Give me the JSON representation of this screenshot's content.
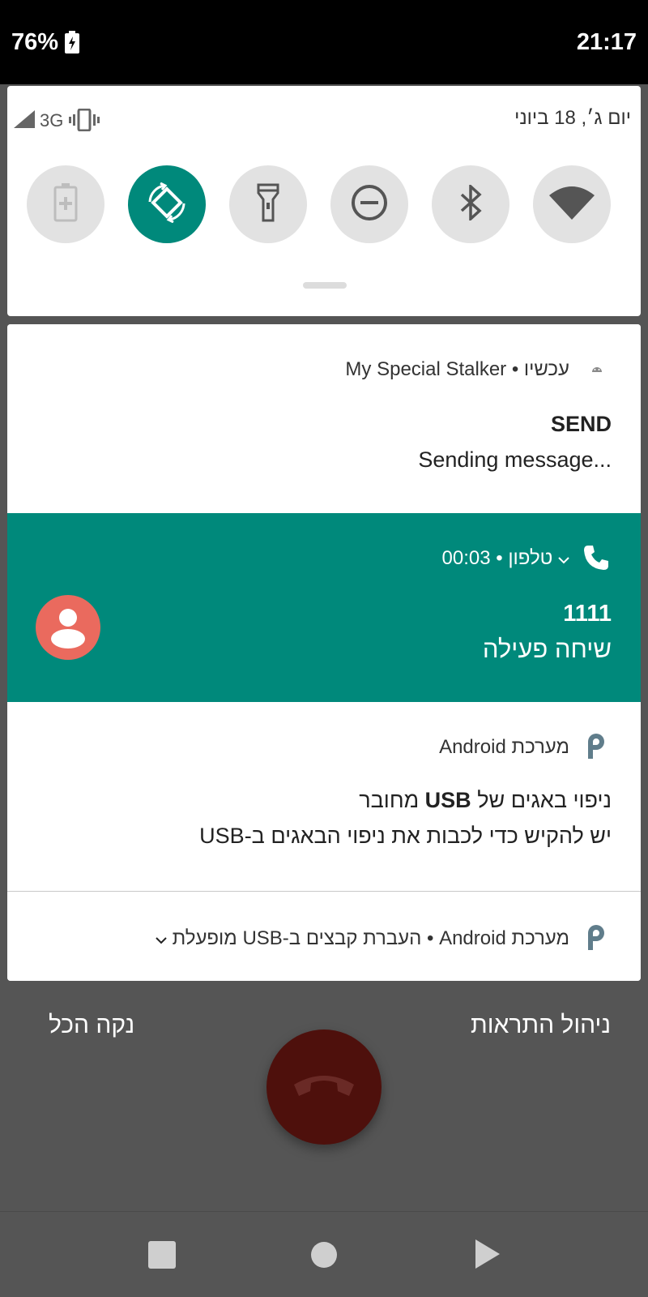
{
  "status_bar": {
    "battery": "76%",
    "clock": "21:17",
    "icons": [
      "battery-charging-icon"
    ]
  },
  "quick_settings": {
    "network_type": "3G",
    "date": "יום ג׳, 18 ביוני",
    "icons": [
      "signal-icon",
      "vibrate-icon"
    ],
    "tiles": [
      {
        "icon": "battery-saver-icon",
        "active": false
      },
      {
        "icon": "auto-rotate-icon",
        "active": true
      },
      {
        "icon": "flashlight-icon",
        "active": false
      },
      {
        "icon": "do-not-disturb-icon",
        "active": false
      },
      {
        "icon": "bluetooth-icon",
        "active": false
      },
      {
        "icon": "wifi-icon",
        "active": false
      }
    ]
  },
  "notifications": {
    "stalker": {
      "app_name": "My Special Stalker",
      "time": "עכשיו",
      "title": "SEND",
      "text": "Sending message..."
    },
    "call": {
      "app_name": "טלפון",
      "duration": "00:03",
      "caller": "1111",
      "status": "שיחה פעילה"
    },
    "usb_debug": {
      "app_name": "מערכת Android",
      "title_prefix": "ניפוי באגים של",
      "title_bold": "USB",
      "title_suffix": "מחובר",
      "text": "יש להקיש כדי לכבות את ניפוי הבאגים ב-USB"
    },
    "usb_transfer": {
      "app_name": "מערכת Android",
      "text": "העברת קבצים ב-USB מופעלת"
    }
  },
  "footer": {
    "manage": "ניהול התראות",
    "clear_all": "נקה הכל"
  },
  "colors": {
    "accent": "#00897b",
    "avatar": "#ea6a5e",
    "end_call": "#4e100c",
    "background": "#555555"
  }
}
